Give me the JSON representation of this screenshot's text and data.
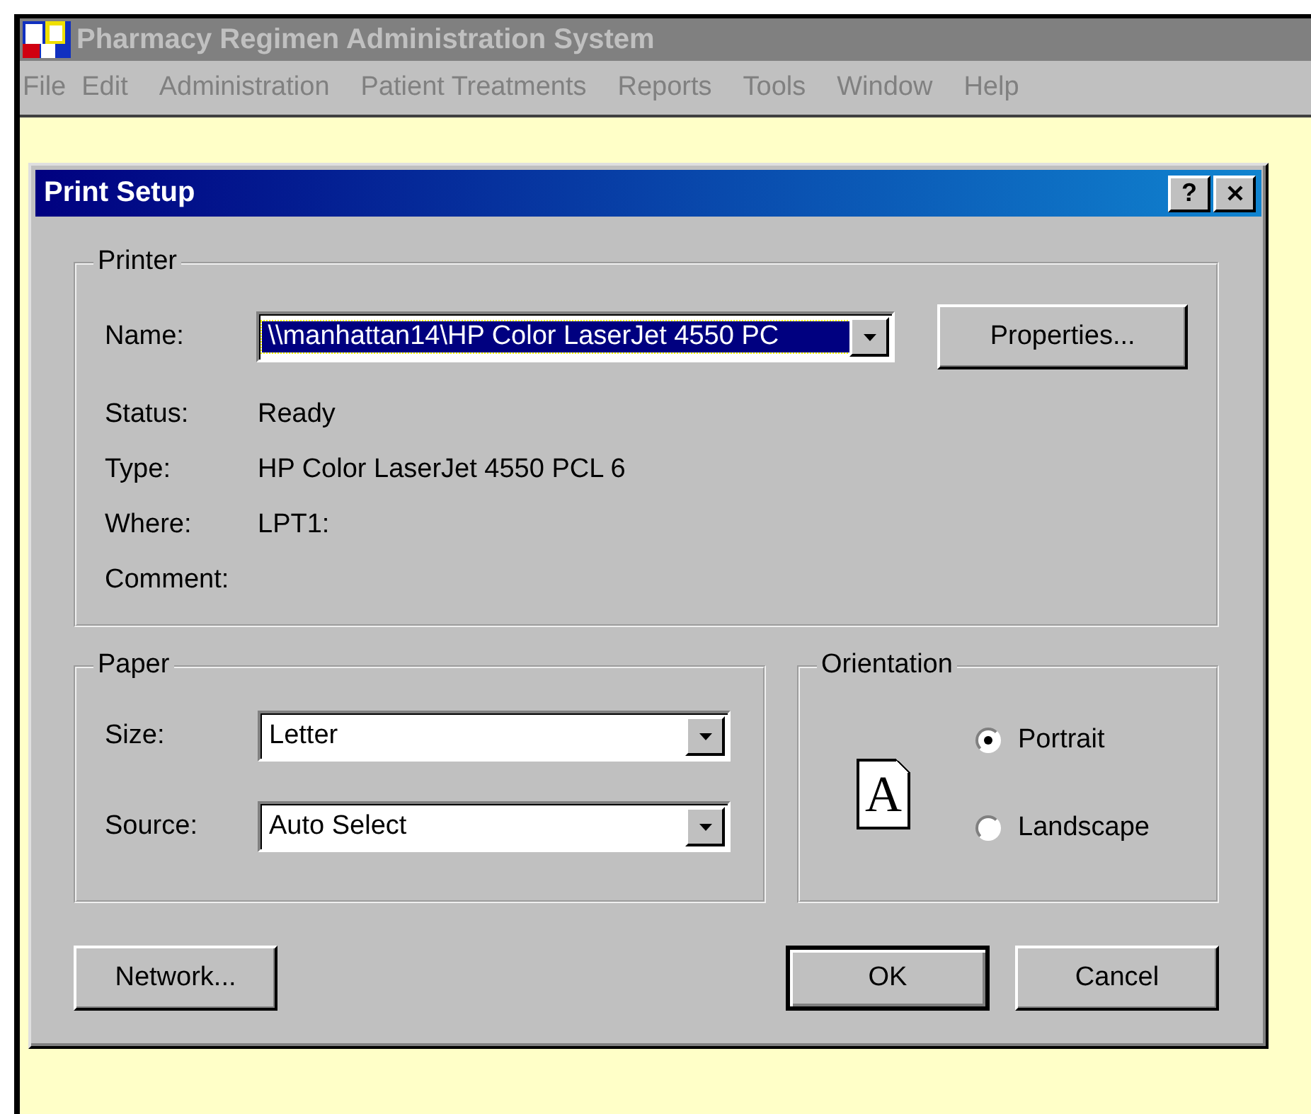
{
  "app": {
    "title": "Pharmacy Regimen Administration System",
    "active": false
  },
  "menu": [
    {
      "label": "File"
    },
    {
      "label": "Edit"
    },
    {
      "label": "Administration"
    },
    {
      "label": "Patient Treatments"
    },
    {
      "label": "Reports"
    },
    {
      "label": "Tools"
    },
    {
      "label": "Window"
    },
    {
      "label": "Help"
    }
  ],
  "dialog": {
    "title": "Print Setup",
    "title_buttons": [
      "?"
    ],
    "printer": {
      "legend": "Printer",
      "name_label": "Name:",
      "name_value": "\\\\manhattan14\\HP Color LaserJet 4550 PC",
      "properties_button": "Properties...",
      "info": [
        {
          "label": "Status:",
          "value": "Ready"
        },
        {
          "label": "Type:",
          "value": "HP Color LaserJet 4550 PCL 6"
        },
        {
          "label": "Where:",
          "value": "LPT1:"
        },
        {
          "label": "Comment:"
        }
      ]
    },
    "paper": {
      "legend": "Paper",
      "fields": [
        {
          "label": "Size:",
          "value": "Letter"
        },
        {
          "label": "Source:",
          "value": "Auto Select"
        }
      ]
    },
    "orientation": {
      "legend": "Orientation",
      "page_glyph": "A",
      "options": [
        {
          "label": "Portrait",
          "selected": true
        },
        {
          "label": "Landscape",
          "selected": false
        }
      ]
    },
    "buttons": [
      {
        "label": "Network...",
        "default": false
      },
      {
        "label": "OK",
        "default": true
      },
      {
        "label": "Cancel",
        "default": false
      }
    ]
  }
}
